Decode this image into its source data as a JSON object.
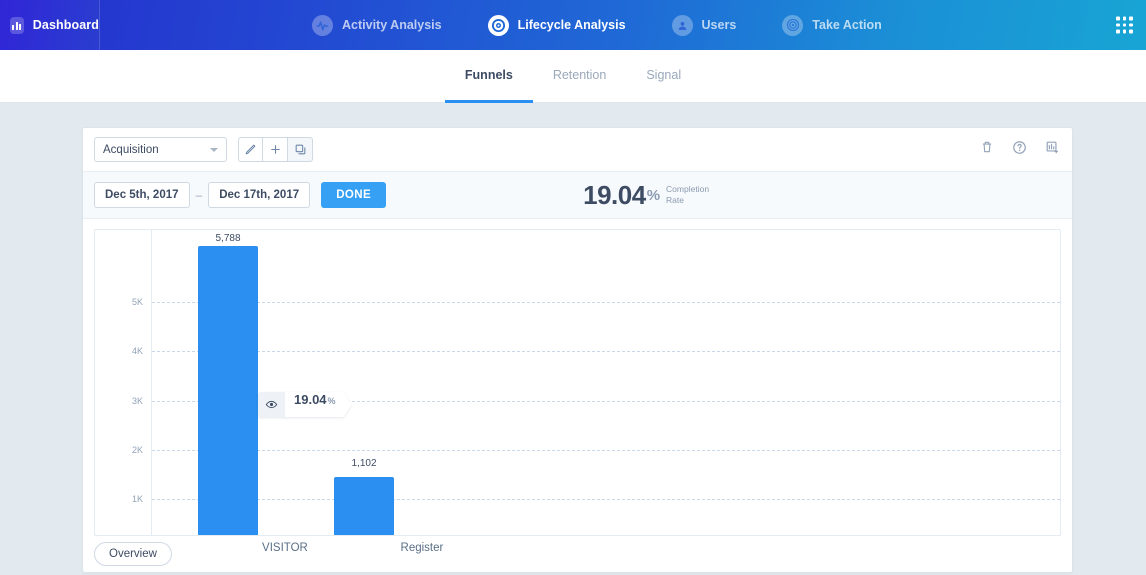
{
  "nav": {
    "brand": {
      "label": "Dashboard",
      "icon": "bar-chart-icon"
    },
    "items": [
      {
        "label": "Activity Analysis",
        "icon": "activity-pulse-icon",
        "active": false
      },
      {
        "label": "Lifecycle Analysis",
        "icon": "lifecycle-target-icon",
        "active": true
      },
      {
        "label": "Users",
        "icon": "user-icon",
        "active": false
      },
      {
        "label": "Take Action",
        "icon": "target-rings-icon",
        "active": false
      }
    ],
    "apps_icon": "grid-apps-icon"
  },
  "tabs": [
    {
      "label": "Funnels",
      "active": true
    },
    {
      "label": "Retention",
      "active": false
    },
    {
      "label": "Signal",
      "active": false
    }
  ],
  "toolbar": {
    "funnel_select": "Acquisition",
    "edit_icon": "pencil-icon",
    "add_icon": "plus-icon",
    "duplicate_icon": "copy-icon",
    "delete_icon": "trash-icon",
    "help_icon": "question-circle-icon",
    "save_chart_icon": "save-chart-icon"
  },
  "daterange": {
    "start": "Dec 5th, 2017",
    "separator": "–",
    "end": "Dec 17th, 2017",
    "done_label": "DONE"
  },
  "completion": {
    "value": "19.04",
    "percent": "%",
    "label_line1": "Completion",
    "label_line2": "Rate"
  },
  "conversion_badge": {
    "eye_icon": "eye-icon",
    "value": "19.04",
    "unit": "%"
  },
  "footer": {
    "overview_label": "Overview"
  },
  "colors": {
    "bar": "#2a8ff0",
    "accent": "#35a0f4",
    "nav_gradient_start": "#2a1fd6",
    "nav_gradient_end": "#18a5d4",
    "page_bg": "#e3eaef",
    "text_dark": "#3d4b63",
    "text_muted": "#93a3b8"
  },
  "chart_data": {
    "type": "bar",
    "title": "",
    "xlabel": "",
    "ylabel": "",
    "categories": [
      "VISITOR",
      "Register"
    ],
    "values": [
      5788,
      1102
    ],
    "value_labels": [
      "5,788",
      "1,102"
    ],
    "ylim": [
      0,
      6000
    ],
    "yticks": [
      5000,
      4000,
      3000,
      2000,
      1000
    ],
    "ytick_labels": [
      "5K",
      "4K",
      "3K",
      "2K",
      "1K"
    ],
    "grid": true,
    "legend": "none",
    "annotations": [
      {
        "text": "19.04%",
        "between": [
          "VISITOR",
          "Register"
        ],
        "type": "conversion-rate"
      }
    ]
  }
}
